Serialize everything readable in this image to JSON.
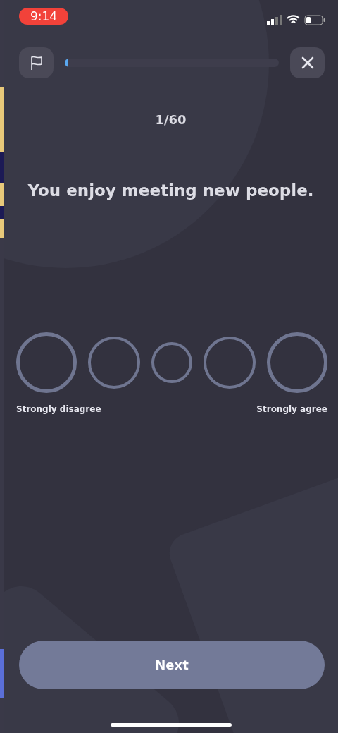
{
  "status_bar": {
    "time": "9:14"
  },
  "header": {
    "progress": {
      "level": 0.01
    }
  },
  "counter": "1/60",
  "question": "You enjoy meeting new people.",
  "options": [
    {
      "selected": false
    },
    {
      "selected": false
    },
    {
      "selected": false
    },
    {
      "selected": false
    },
    {
      "selected": false
    }
  ],
  "scale_labels": {
    "left": "Strongly disagree",
    "right": "Strongly agree"
  },
  "next_button": {
    "label": "Next",
    "disabled": true
  }
}
